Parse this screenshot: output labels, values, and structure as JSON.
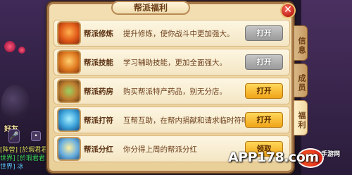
{
  "panel": {
    "title": "帮派福利",
    "close_label": "✕"
  },
  "rows": [
    {
      "name": "帮派修炼",
      "desc": "提升修炼，使你战斗中更加强大。",
      "button": "打开",
      "button_style": "gray",
      "icon": "cultivation-icon"
    },
    {
      "name": "帮派技能",
      "desc": "学习辅助技能，更加全面强大。",
      "button": "打开",
      "button_style": "gray",
      "icon": "skill-icon"
    },
    {
      "name": "帮派药房",
      "desc": "购买帮派特产药品，别无分店。",
      "button": "打开",
      "button_style": "gold",
      "icon": "pharmacy-icon"
    },
    {
      "name": "帮派打符",
      "desc": "互帮互助，在帮内捐献和请求临时符吧。",
      "button": "打开",
      "button_style": "gold",
      "icon": "talisman-icon"
    },
    {
      "name": "帮派分红",
      "desc": "你分得上周的帮派分红",
      "button": "领取",
      "button_style": "gold",
      "icon": "dividend-icon"
    }
  ],
  "tabs": {
    "info": "信息",
    "members": "成员",
    "welfare": "福利"
  },
  "left": {
    "player_tag": "好友",
    "mic_label": "🎤",
    "chat_label": "•",
    "chat": [
      "[阵营] [於瑕君君...",
      "世界] [於瑕君君...",
      "世界] 冰"
    ]
  },
  "watermark": {
    "text": "APP178.com",
    "sub": "手游网"
  }
}
